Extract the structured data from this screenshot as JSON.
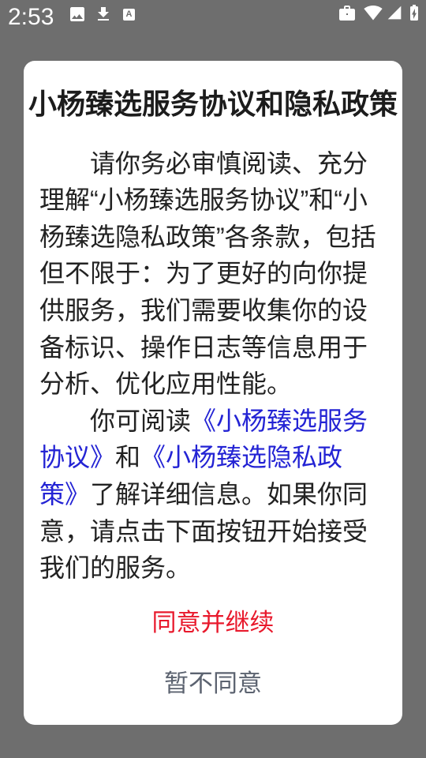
{
  "status_bar": {
    "time": "2:53",
    "notification_icons": [
      "image-icon",
      "download-icon",
      "text-a-icon"
    ],
    "text_icon_letter": "A",
    "system_icons": [
      "work-profile-icon",
      "wifi-icon",
      "cellular-signal-icon",
      "battery-charging-icon"
    ]
  },
  "dialog": {
    "title": "小杨臻选服务协议和隐私政策",
    "paragraph_1": [
      "请你务必审慎阅读、充分",
      "理解“小杨臻选服务协议”和“小",
      "杨臻选隐私政策”各条款，包括",
      "但不限于：为了更好的向你提",
      "供服务，我们需要收集你的设",
      "备标识、操作日志等信息用于",
      "分析、优化应用性能。"
    ],
    "paragraph_2": {
      "line_1_text": "你可阅读",
      "service_agreement_link_part_1": "《小杨臻选服务",
      "service_agreement_link_part_2": "协议》",
      "line_2_text": "和",
      "privacy_policy_link_part_1": "《小杨臻选隐私政",
      "privacy_policy_link_part_2": "策》",
      "line_3_text": "了解详细信息。如果你同",
      "line_4_text": "意，请点击下面按钮开始接受",
      "line_5_text": "我们的服务。"
    },
    "agree_label": "同意并继续",
    "disagree_label": "暂不同意"
  },
  "colors": {
    "backdrop": "#6e6e6e",
    "status_bar_foreground": "#ffffff",
    "dialog_background": "#ffffff",
    "title_text": "#1c1c1c",
    "body_text": "#222222",
    "link": "#2323d4",
    "agree_button_text": "#e8192c",
    "disagree_button_text": "#5c6370"
  }
}
